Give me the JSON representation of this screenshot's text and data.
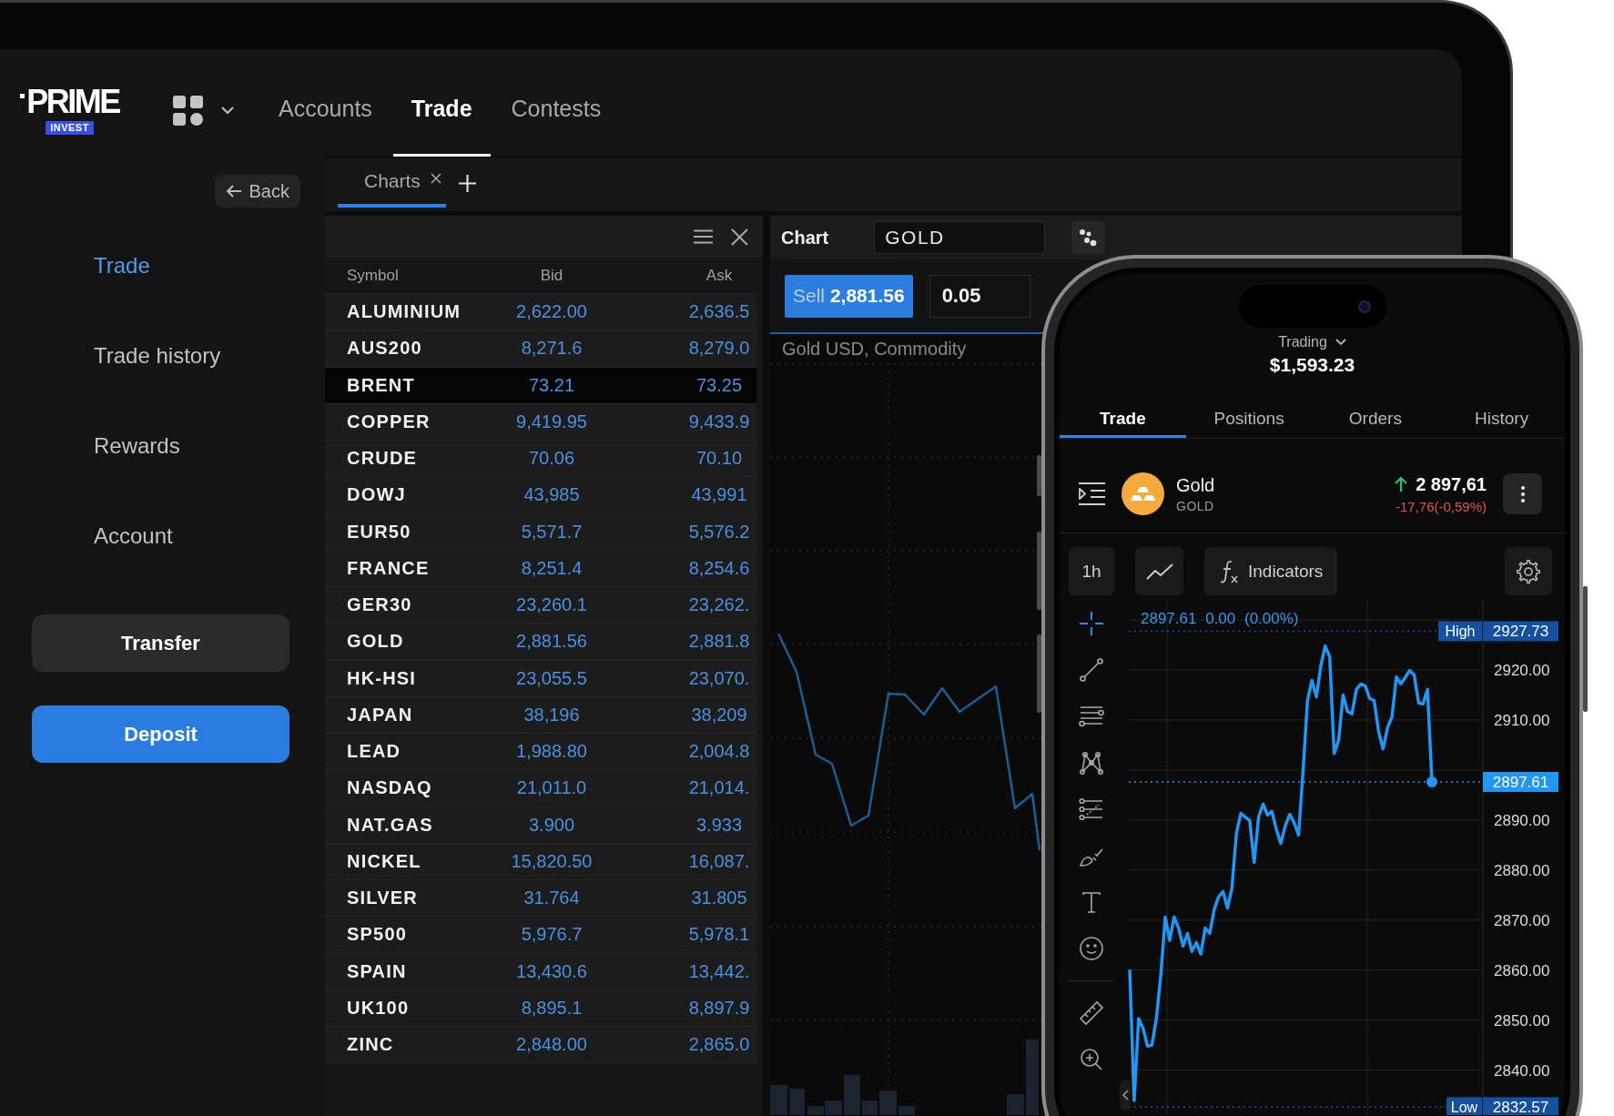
{
  "brand": {
    "name": "PRIME",
    "badge": "INVEST"
  },
  "nav": [
    {
      "label": "Accounts",
      "selected": false
    },
    {
      "label": "Trade",
      "selected": true
    },
    {
      "label": "Contests",
      "selected": false
    }
  ],
  "sidebar": {
    "back": "Back",
    "items": [
      {
        "label": "Trade",
        "selected": true
      },
      {
        "label": "Trade history",
        "selected": false
      },
      {
        "label": "Rewards",
        "selected": false
      },
      {
        "label": "Account",
        "selected": false
      }
    ],
    "buttons": [
      {
        "label": "Transfer",
        "kind": "secondary"
      },
      {
        "label": "Deposit",
        "kind": "primary"
      }
    ]
  },
  "workspace_tabs": [
    {
      "label": "Charts",
      "selected": true
    }
  ],
  "watchlist": {
    "columns": [
      "Symbol",
      "Bid",
      "Ask"
    ],
    "rows": [
      {
        "symbol": "ALUMINIUM",
        "bid": "2,622.00",
        "ask": "2,636.5",
        "selected": false
      },
      {
        "symbol": "AUS200",
        "bid": "8,271.6",
        "ask": "8,279.0",
        "selected": false
      },
      {
        "symbol": "BRENT",
        "bid": "73.21",
        "ask": "73.25",
        "selected": true
      },
      {
        "symbol": "COPPER",
        "bid": "9,419.95",
        "ask": "9,433.9",
        "selected": false
      },
      {
        "symbol": "CRUDE",
        "bid": "70.06",
        "ask": "70.10",
        "selected": false
      },
      {
        "symbol": "DOWJ",
        "bid": "43,985",
        "ask": "43,991",
        "selected": false
      },
      {
        "symbol": "EUR50",
        "bid": "5,571.7",
        "ask": "5,576.2",
        "selected": false
      },
      {
        "symbol": "FRANCE",
        "bid": "8,251.4",
        "ask": "8,254.6",
        "selected": false
      },
      {
        "symbol": "GER30",
        "bid": "23,260.1",
        "ask": "23,262.",
        "selected": false
      },
      {
        "symbol": "GOLD",
        "bid": "2,881.56",
        "ask": "2,881.8",
        "selected": false
      },
      {
        "symbol": "HK-HSI",
        "bid": "23,055.5",
        "ask": "23,070.",
        "selected": false
      },
      {
        "symbol": "JAPAN",
        "bid": "38,196",
        "ask": "38,209",
        "selected": false
      },
      {
        "symbol": "LEAD",
        "bid": "1,988.80",
        "ask": "2,004.8",
        "selected": false
      },
      {
        "symbol": "NASDAQ",
        "bid": "21,011.0",
        "ask": "21,014.",
        "selected": false
      },
      {
        "symbol": "NAT.GAS",
        "bid": "3.900",
        "ask": "3.933",
        "selected": false
      },
      {
        "symbol": "NICKEL",
        "bid": "15,820.50",
        "ask": "16,087.",
        "selected": false
      },
      {
        "symbol": "SILVER",
        "bid": "31.764",
        "ask": "31.805",
        "selected": false
      },
      {
        "symbol": "SP500",
        "bid": "5,976.7",
        "ask": "5,978.1",
        "selected": false
      },
      {
        "symbol": "SPAIN",
        "bid": "13,430.6",
        "ask": "13,442.",
        "selected": false
      },
      {
        "symbol": "UK100",
        "bid": "8,895.1",
        "ask": "8,897.9",
        "selected": false
      },
      {
        "symbol": "ZINC",
        "bid": "2,848.00",
        "ask": "2,865.0",
        "selected": false
      }
    ]
  },
  "chart_panel": {
    "title": "Chart",
    "symbol": "GOLD",
    "sell_label": "Sell",
    "sell_price": "2,881.56",
    "quantity": "0.05",
    "description": "Gold USD, Commodity"
  },
  "phone": {
    "account_type": "Trading",
    "balance": "$1,593.23",
    "tabs": [
      {
        "label": "Trade",
        "selected": true
      },
      {
        "label": "Positions",
        "selected": false
      },
      {
        "label": "Orders",
        "selected": false
      },
      {
        "label": "History",
        "selected": false
      }
    ],
    "instrument": {
      "name": "Gold",
      "symbol": "GOLD",
      "price": "2 897,61",
      "change": "-17,76(-0,59%)",
      "rising": true
    },
    "toolbar": {
      "interval": "1h",
      "indicators": "Indicators"
    },
    "tool_groups": [
      {
        "tools": [
          {
            "kind": "crosshair",
            "selected": true
          },
          {
            "kind": "trendline",
            "selected": false
          },
          {
            "kind": "lines",
            "selected": false
          },
          {
            "kind": "pattern",
            "selected": false
          },
          {
            "kind": "fibonacci",
            "selected": false
          },
          {
            "kind": "brush",
            "selected": false
          },
          {
            "kind": "text",
            "selected": false
          },
          {
            "kind": "emoji",
            "selected": false
          }
        ]
      },
      {
        "tools": [
          {
            "kind": "ruler",
            "selected": false
          },
          {
            "kind": "zoom",
            "selected": false
          }
        ]
      }
    ],
    "quote": "2897.61 0.00 (0.00%)",
    "price_tags": [
      {
        "label": "High",
        "value": "2927.73"
      },
      {
        "value": "2897.61"
      },
      {
        "label": "Low",
        "value": "2832.57"
      }
    ],
    "chart_data": {
      "type": "line",
      "grid": true,
      "ylim": [
        2831,
        2934
      ],
      "yticks": [
        {
          "value": 2840,
          "label": "2840.00"
        },
        {
          "value": 2850,
          "label": "2850.00"
        },
        {
          "value": 2860,
          "label": "2860.00"
        },
        {
          "value": 2870,
          "label": "2870.00"
        },
        {
          "value": 2880,
          "label": "2880.00"
        },
        {
          "value": 2890,
          "label": "2890.00"
        },
        {
          "value": 2910,
          "label": "2910.00"
        },
        {
          "value": 2920,
          "label": "2920.00"
        }
      ],
      "series": [
        {
          "color": "#2196f3",
          "values": [
            2860.1,
            2833.9,
            2850.3,
            2848.4,
            2844.8,
            2845.0,
            2850.3,
            2859.0,
            2870.6,
            2865.9,
            2870.6,
            2868.4,
            2864.8,
            2867.3,
            2863.7,
            2865.5,
            2863.2,
            2868.4,
            2867.3,
            2872.1,
            2874.6,
            2875.7,
            2872.4,
            2876.4,
            2887.3,
            2891.3,
            2890.6,
            2889.9,
            2881.5,
            2890.6,
            2893.2,
            2891.0,
            2891.7,
            2888.1,
            2885.3,
            2888.8,
            2891.1,
            2889.5,
            2887.0,
            2899.7,
            2913.9,
            2917.9,
            2914.6,
            2920.8,
            2924.8,
            2922.6,
            2903.3,
            2905.9,
            2915.0,
            2911.7,
            2911.2,
            2916.1,
            2917.2,
            2916.8,
            2914.3,
            2913.9,
            2907.7,
            2904.2,
            2908.4,
            2910.6,
            2918.6,
            2917.2,
            2918.5,
            2919.9,
            2919.0,
            2913.4,
            2913.2,
            2916.1,
            2897.6
          ]
        }
      ],
      "ref_lines": [
        {
          "axis": "y",
          "value": 2927.73,
          "color": "#1450a0"
        },
        {
          "axis": "y",
          "value": 2897.61,
          "color": "#2196f3"
        },
        {
          "axis": "y",
          "value": 2832.57,
          "color": "#1450a0"
        }
      ]
    }
  }
}
